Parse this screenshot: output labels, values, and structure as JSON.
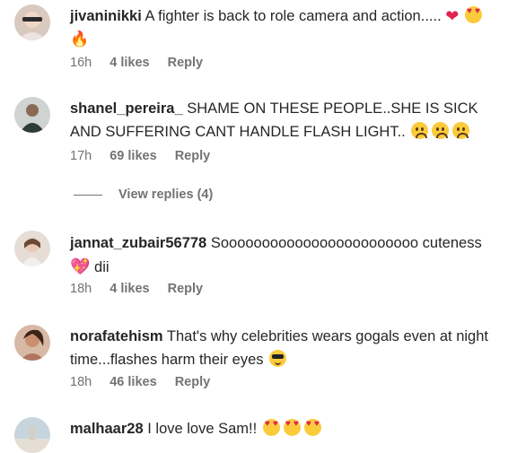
{
  "colors": {
    "text": "#262626",
    "muted": "#737373",
    "heart": "#e0244f"
  },
  "comments": [
    {
      "username": "jivaninikki",
      "text": "A fighter is back to role camera and action.....",
      "emojis": [
        "heart",
        "smiling-face-with-heart-eyes",
        "fire"
      ],
      "time": "16h",
      "likes": "4 likes",
      "reply": "Reply"
    },
    {
      "username": "shanel_pereira_",
      "text": "SHAME ON THESE PEOPLE..SHE IS SICK AND SUFFERING CANT HANDLE FLASH LIGHT..",
      "emojis": [
        "pleading-face",
        "pleading-face",
        "pleading-face"
      ],
      "time": "17h",
      "likes": "69 likes",
      "reply": "Reply",
      "view_replies": "View replies (4)"
    },
    {
      "username": "jannat_zubair56778",
      "text": "Soooooooooooooooooooooooo cuteness",
      "text_after": "dii",
      "emojis": [
        "sparkling-heart"
      ],
      "time": "18h",
      "likes": "4 likes",
      "reply": "Reply"
    },
    {
      "username": "norafatehism",
      "text": "That's why celebrities wears gogals even at night time...flashes harm their eyes",
      "emojis": [
        "smiling-face-with-sunglasses"
      ],
      "time": "18h",
      "likes": "46 likes",
      "reply": "Reply"
    },
    {
      "username": "malhaar28",
      "text": "I love love Sam!!",
      "emojis": [
        "smiling-face-with-heart-eyes",
        "smiling-face-with-heart-eyes",
        "smiling-face-with-heart-eyes"
      ]
    }
  ]
}
